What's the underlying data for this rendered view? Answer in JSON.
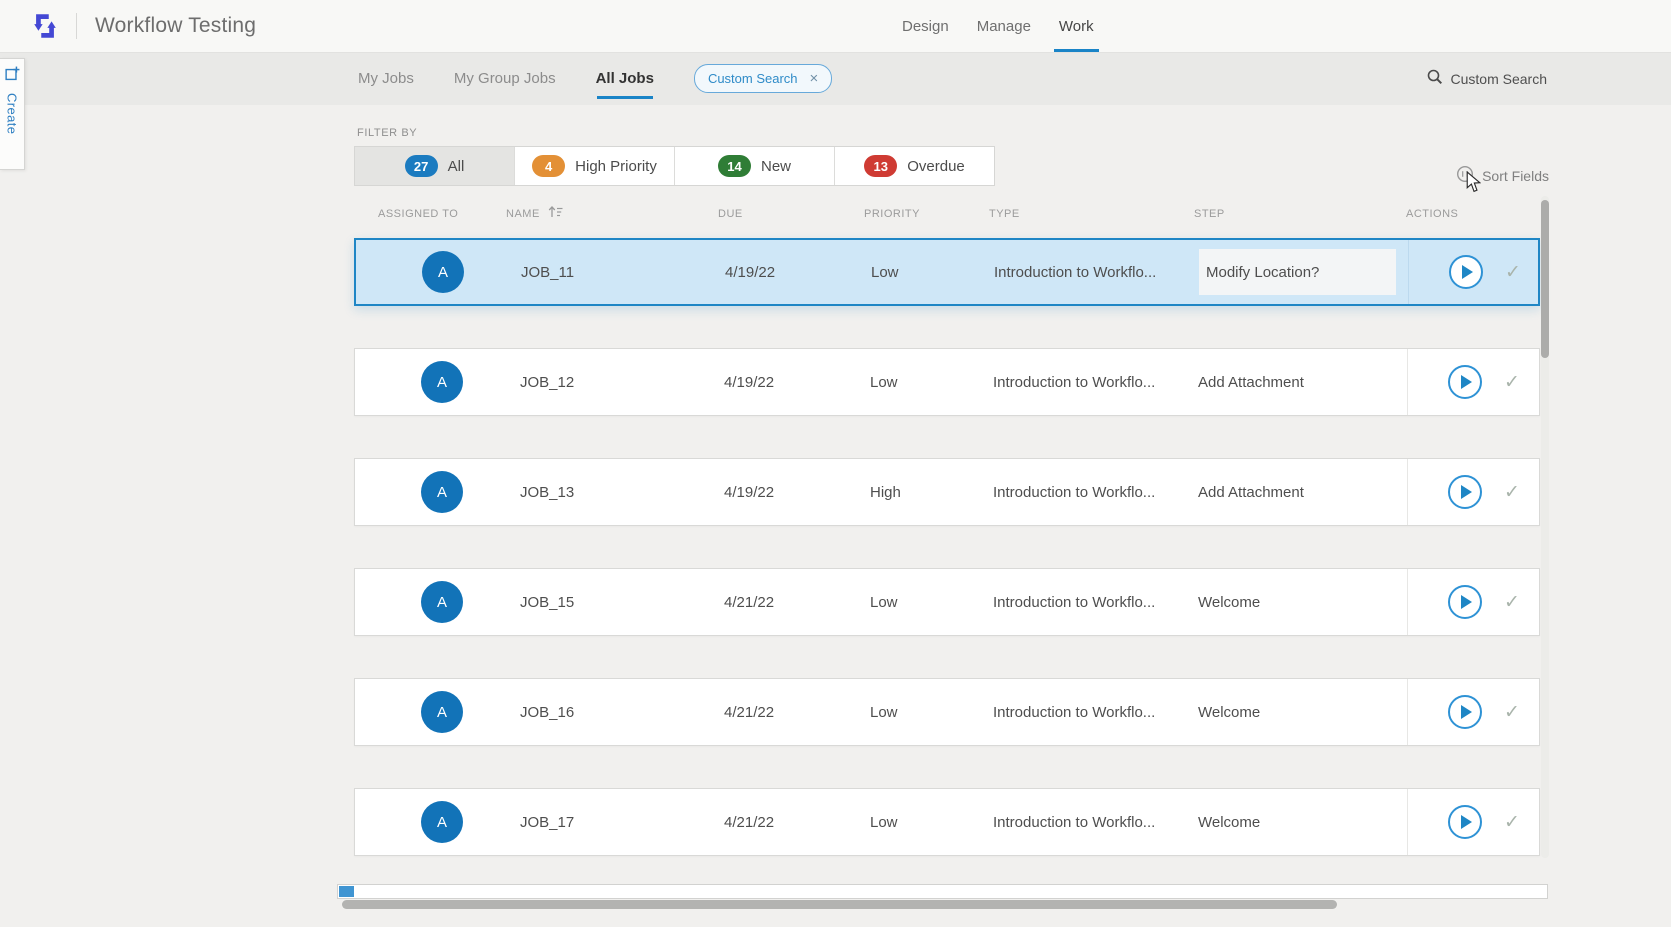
{
  "header": {
    "app_title": "Workflow Testing",
    "nav": [
      {
        "label": "Design",
        "active": false
      },
      {
        "label": "Manage",
        "active": false
      },
      {
        "label": "Work",
        "active": true
      }
    ]
  },
  "create_tab": {
    "label": "Create"
  },
  "tabs": {
    "items": [
      {
        "label": "My Jobs",
        "active": false
      },
      {
        "label": "My Group Jobs",
        "active": false
      },
      {
        "label": "All Jobs",
        "active": true
      }
    ],
    "chip": {
      "label": "Custom Search",
      "close": "×"
    },
    "search_link": {
      "label": "Custom Search"
    }
  },
  "filter": {
    "label": "FILTER BY",
    "items": [
      {
        "count": "27",
        "label": "All",
        "badge_color": "#1b7bc0",
        "selected": true
      },
      {
        "count": "4",
        "label": "High Priority",
        "badge_color": "#e39036",
        "selected": false
      },
      {
        "count": "14",
        "label": "New",
        "badge_color": "#2f7d36",
        "selected": false
      },
      {
        "count": "13",
        "label": "Overdue",
        "badge_color": "#cf3b33",
        "selected": false
      }
    ]
  },
  "sort_fields": {
    "label": "Sort Fields"
  },
  "table": {
    "columns": [
      "ASSIGNED TO",
      "NAME",
      "DUE",
      "PRIORITY",
      "TYPE",
      "STEP",
      "ACTIONS"
    ],
    "rows": [
      {
        "avatar": "A",
        "name": "JOB_11",
        "due": "4/19/22",
        "priority": "Low",
        "type": "Introduction to Workflo...",
        "step": "Modify Location?",
        "selected": true
      },
      {
        "avatar": "A",
        "name": "JOB_12",
        "due": "4/19/22",
        "priority": "Low",
        "type": "Introduction to Workflo...",
        "step": "Add Attachment",
        "selected": false
      },
      {
        "avatar": "A",
        "name": "JOB_13",
        "due": "4/19/22",
        "priority": "High",
        "type": "Introduction to Workflo...",
        "step": "Add Attachment",
        "selected": false
      },
      {
        "avatar": "A",
        "name": "JOB_15",
        "due": "4/21/22",
        "priority": "Low",
        "type": "Introduction to Workflo...",
        "step": "Welcome",
        "selected": false
      },
      {
        "avatar": "A",
        "name": "JOB_16",
        "due": "4/21/22",
        "priority": "Low",
        "type": "Introduction to Workflo...",
        "step": "Welcome",
        "selected": false
      },
      {
        "avatar": "A",
        "name": "JOB_17",
        "due": "4/21/22",
        "priority": "Low",
        "type": "Introduction to Workflo...",
        "step": "Welcome",
        "selected": false
      }
    ]
  },
  "icons": {
    "check": "✓"
  },
  "colors": {
    "accent_blue": "#1a84c7",
    "selected_row_bg": "#cfe7f7",
    "selected_row_border": "#1f86c5",
    "avatar_blue": "#1273b8",
    "logo_purple": "#4448d4"
  }
}
